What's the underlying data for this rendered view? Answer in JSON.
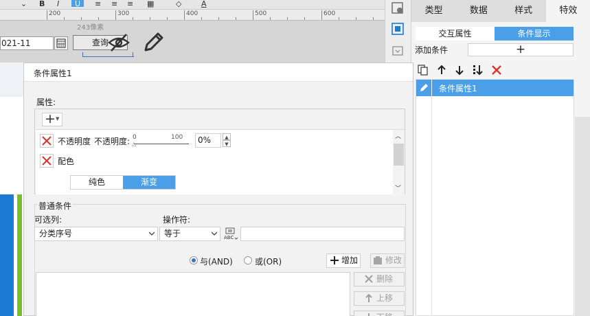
{
  "editor": {
    "ruler_labels": [
      "200",
      "300",
      "400",
      "500",
      "600"
    ],
    "dimension_label": "243像素",
    "date_value": "021-11",
    "query_label": "查询"
  },
  "right_panel": {
    "tabs": [
      "类型",
      "数据",
      "样式",
      "特效"
    ],
    "active_tab": "特效",
    "subtabs": [
      "交互属性",
      "条件显示"
    ],
    "active_subtab": "条件显示",
    "add_condition_label": "添加条件",
    "add_condition_symbol": "+",
    "conditions": [
      "条件属性1"
    ]
  },
  "dialog": {
    "title": "条件属性1",
    "properties_label": "属性:",
    "opacity_row": {
      "label": "不透明度",
      "slider_label": "不透明度:",
      "slider_min": "0",
      "slider_max": "100",
      "value": "0%"
    },
    "color_row": {
      "label": "配色",
      "fill_options": [
        "纯色",
        "渐变"
      ],
      "active_fill": "渐变"
    },
    "normal_conditions": {
      "title": "普通条件",
      "column_label": "可选列:",
      "operator_label": "操作符:",
      "column_value": "分类序号",
      "operator_value": "等于",
      "and_label": "与(AND)",
      "or_label": "或(OR)",
      "selected_logic": "AND",
      "add_label": "增加",
      "modify_label": "修改",
      "delete_label": "删除",
      "up_label": "上移",
      "down_label": "下移"
    }
  },
  "colors": {
    "accent": "#4b9fe8",
    "delete_red": "#d9342b",
    "chart_blue": "#1a7ad4",
    "chart_green": "#7bbd28"
  }
}
